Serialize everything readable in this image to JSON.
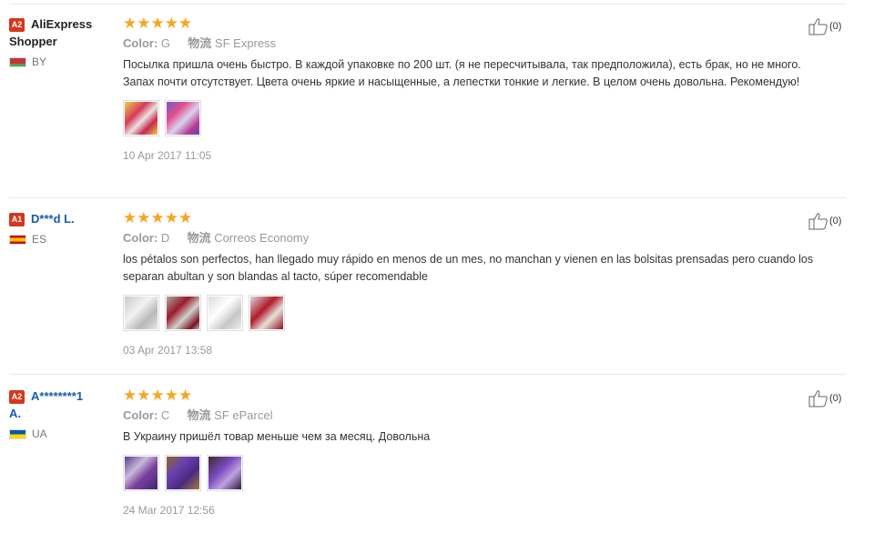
{
  "reviews": [
    {
      "badge": "A2",
      "name_line1": "AliExpress",
      "name_line2": "Shopper",
      "name_style": "black",
      "country": "BY",
      "flag": "by",
      "stars": "★★★★★",
      "color_label": "Color:",
      "color_value": "G",
      "ship_label": "物流",
      "shipping": "SF Express",
      "text": "Посылка пришла очень быстро. В каждой упаковке по 200 шт. (я не пересчитывала, так предположила), есть брак, но не много. Запах почти отсутствует. Цвета очень яркие и насыщенные, а лепестки тонкие и легкие. В целом очень довольна. Рекомендую!",
      "thumbs": [
        "linear-gradient(135deg,#e8d24a 0%,#d83a5a 35%,#e9e3e0 55%,#c8294c 75%,#f2c94c 100%)",
        "linear-gradient(135deg,#6b5bd1 0%,#e24d8c 30%,#d9d3f0 55%,#b63a8e 80%,#5a4ab8 100%)"
      ],
      "date": "10 Apr 2017 11:05",
      "likes": "(0)"
    },
    {
      "badge": "A1",
      "name_line1": "D***d L.",
      "name_line2": "",
      "name_style": "blue",
      "country": "ES",
      "flag": "es",
      "stars": "★★★★★",
      "color_label": "Color:",
      "color_value": "D",
      "ship_label": "物流",
      "shipping": "Correos Economy",
      "text": "los pétalos son perfectos, han llegado muy rápido en menos de un mes, no manchan y vienen en las bolsitas prensadas pero cuando los separan abultan y son blandas al tacto, súper recomendable",
      "thumbs": [
        "linear-gradient(135deg,#c9c9c9 0%,#f2f2f2 40%,#b8b8b8 70%,#e6e6e6 100%)",
        "linear-gradient(135deg,#a9a9a9 0%,#9a1b2a 35%,#d0d0d0 60%,#7a1420 85%,#bbbbbb 100%)",
        "linear-gradient(135deg,#dcdcdc 0%,#ffffff 40%,#c6c6c6 70%,#efefef 100%)",
        "linear-gradient(135deg,#d8d8d8 0%,#b01c2c 40%,#e8e0d8 65%,#8c1020 100%)"
      ],
      "date": "03 Apr 2017 13:58",
      "likes": "(0)"
    },
    {
      "badge": "A2",
      "name_line1": "A********1",
      "name_line2": "A.",
      "name_style": "blue",
      "country": "UA",
      "flag": "ua",
      "stars": "★★★★★",
      "color_label": "Color:",
      "color_value": "C",
      "ship_label": "物流",
      "shipping": "SF eParcel",
      "text": "В Украину пришёл товар меньше чем за месяц. Довольна",
      "thumbs": [
        "linear-gradient(135deg,#5a3c8a 0%,#c9b9d9 35%,#7b3fa0 60%,#3d2a6a 100%)",
        "linear-gradient(135deg,#8a6a2a 0%,#6b3fb0 35%,#4a2a80 65%,#a87a3a 100%)",
        "linear-gradient(135deg,#3a2a2a 0%,#7a4ac0 40%,#c0a0e0 65%,#2a1a3a 100%)"
      ],
      "date": "24 Mar 2017 12:56",
      "likes": "(0)"
    }
  ]
}
